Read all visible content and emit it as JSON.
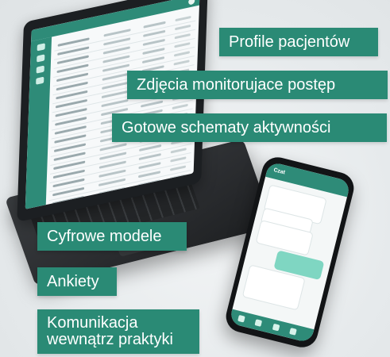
{
  "labels": {
    "profile": "Profile pacjentów",
    "zdjecia": "Zdjęcia monitorujace postęp",
    "schematy": "Gotowe schematy aktywności",
    "cyfrowe": "Cyfrowe modele",
    "ankiety": "Ankiety",
    "komunikacja_line1": "Komunikacja",
    "komunikacja_line2": "wewnątrz praktyki"
  },
  "colors": {
    "accent": "#2a8a75",
    "background": "#eceff1"
  },
  "phone": {
    "header_title": "Czat"
  },
  "icons": [
    "home-icon",
    "chat-icon",
    "flag-icon",
    "user-icon"
  ]
}
